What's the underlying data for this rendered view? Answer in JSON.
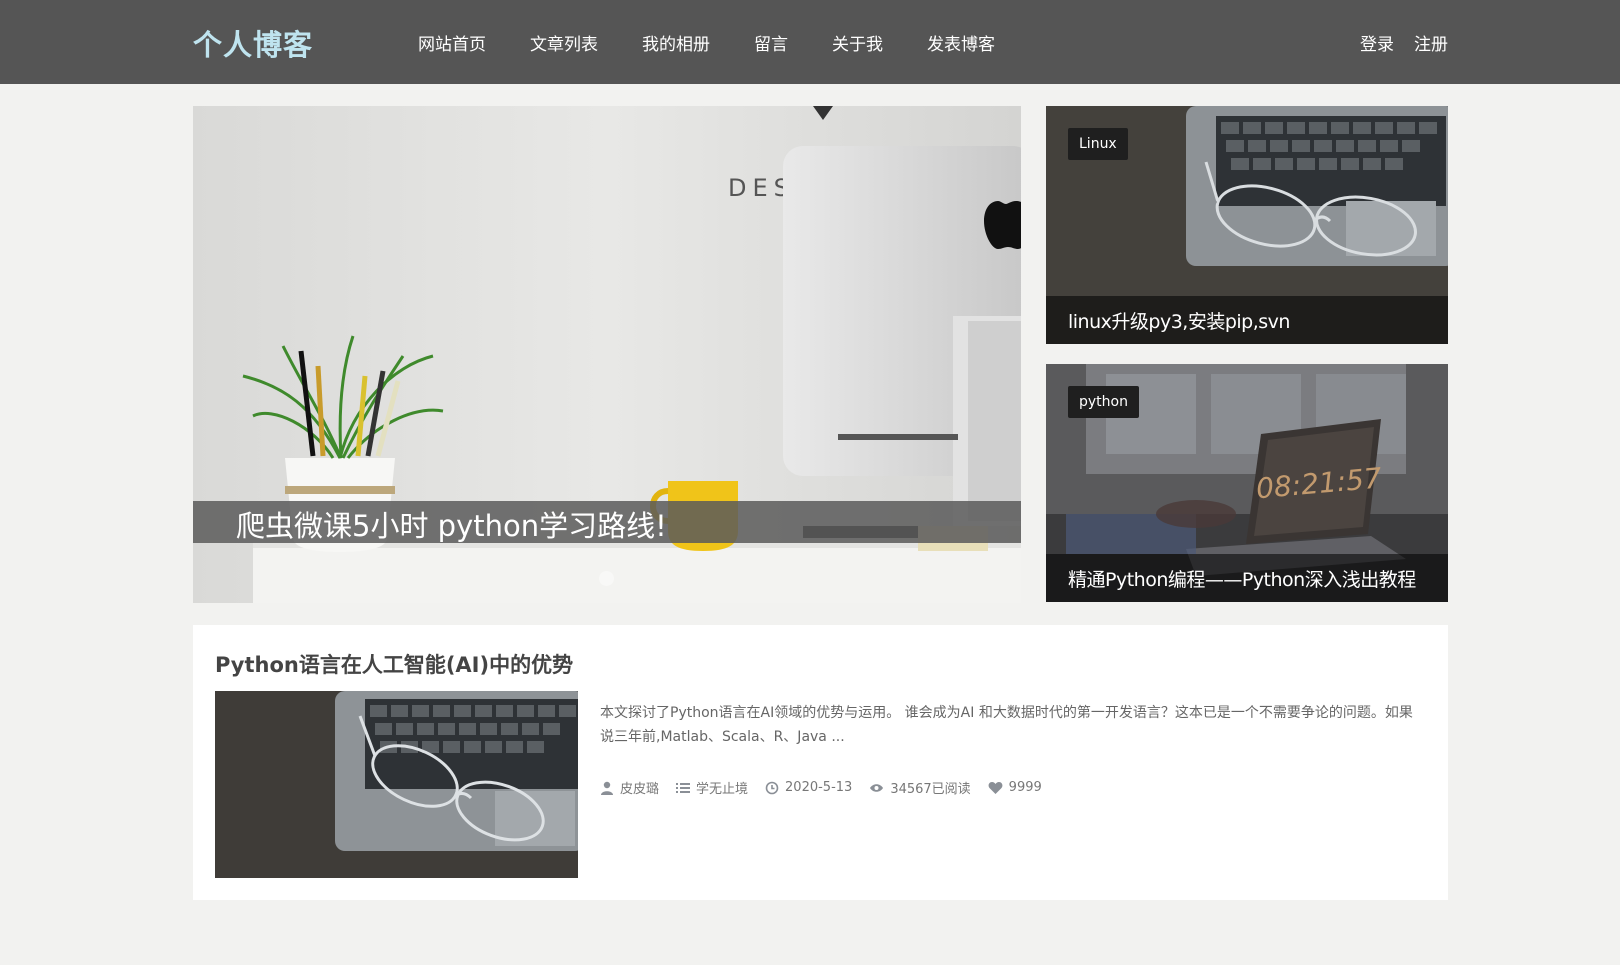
{
  "header": {
    "logo": "个人博客",
    "nav": [
      "网站首页",
      "文章列表",
      "我的相册",
      "留言",
      "关于我",
      "发表博客"
    ],
    "login": "登录",
    "register": "注册",
    "bg_color": "#555555",
    "logo_color": "#bfe4ef"
  },
  "hero": {
    "title": "爬虫微课5小时 python学习路线!",
    "image_text": "DES"
  },
  "side_cards": [
    {
      "tag": "Linux",
      "title": "linux升级py3,安装pip,svn"
    },
    {
      "tag": "python",
      "title": "精通Python编程——Python深入浅出教程",
      "image_text": "08:21:57"
    }
  ],
  "article": {
    "title": "Python语言在人工智能(AI)中的优势",
    "summary": "本文探讨了Python语言在AI领域的优势与运用。 谁会成为AI 和大数据时代的第一开发语言？这本已是一个不需要争论的问题。如果说三年前,Matlab、Scala、R、Java ...",
    "author": "皮皮璐",
    "category": "学无止境",
    "date": "2020-5-13",
    "views": "34567已阅读",
    "likes": "9999"
  }
}
